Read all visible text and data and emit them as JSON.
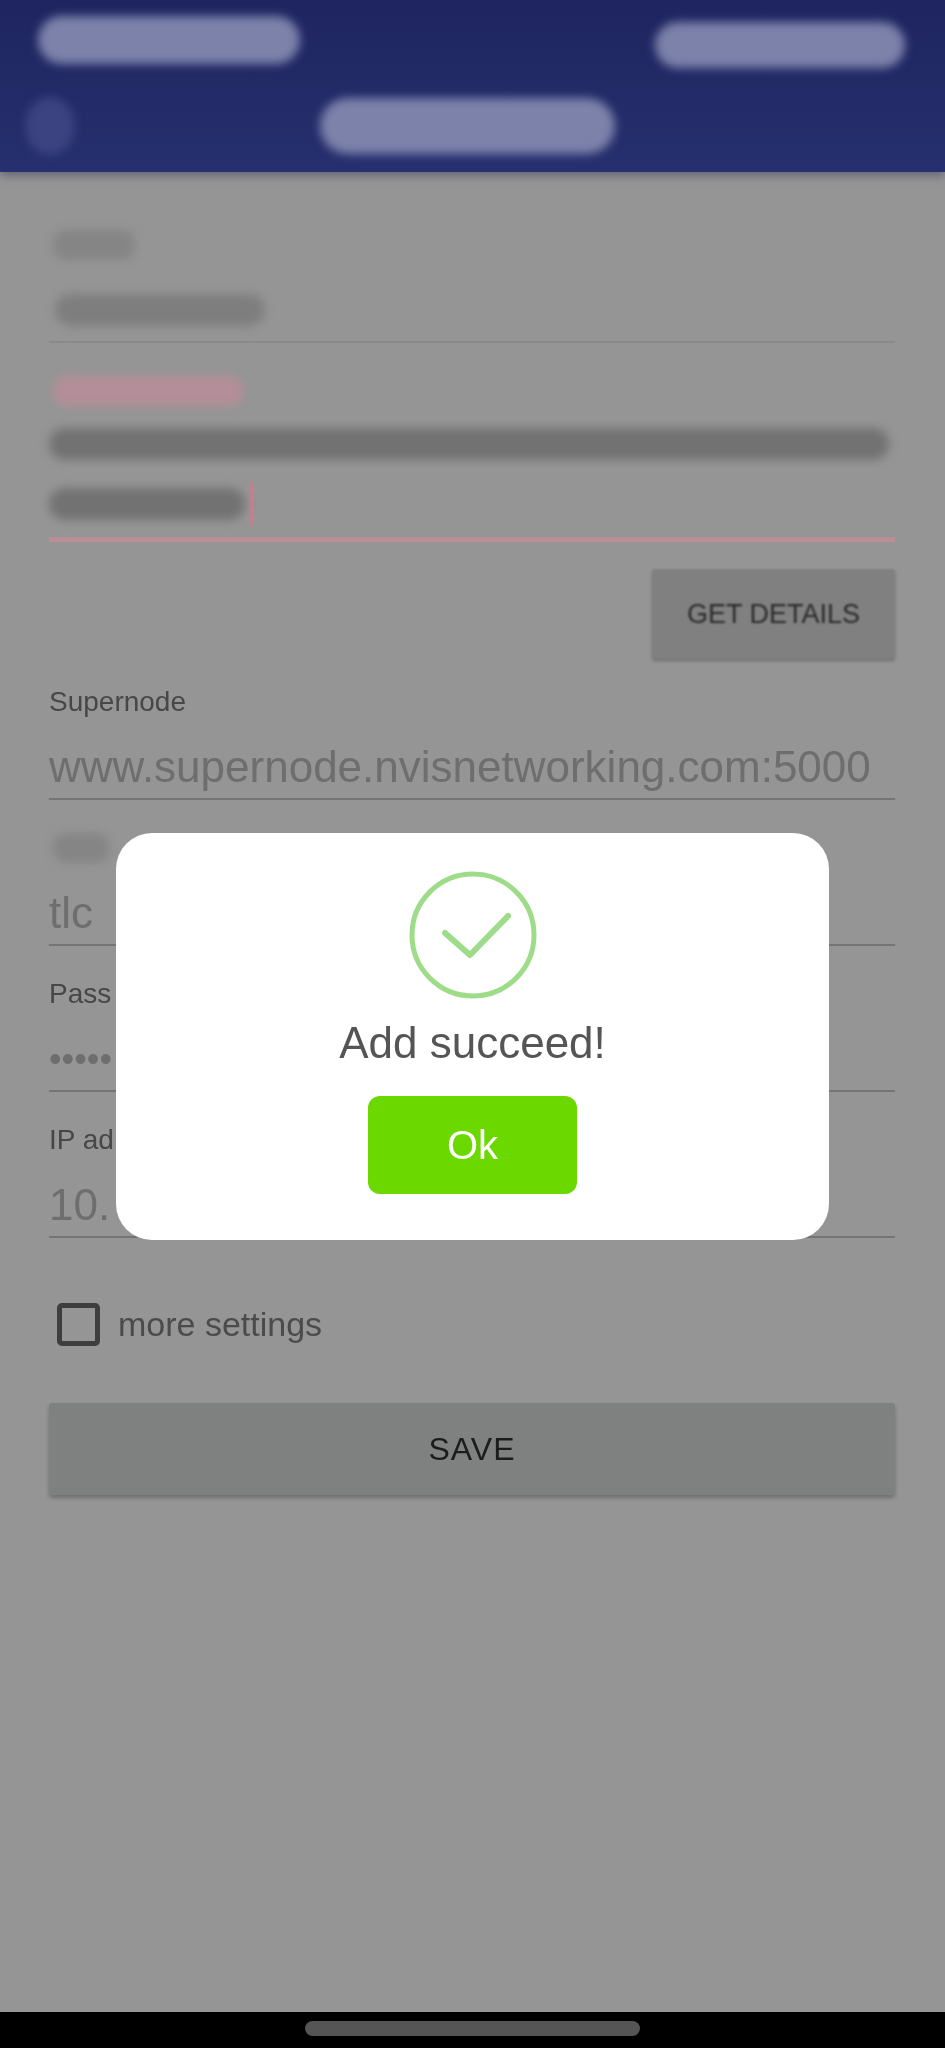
{
  "status_bar": {
    "redacted": true
  },
  "app_bar": {
    "back_redacted": true,
    "title_redacted": true
  },
  "form": [
    {
      "kind": "field",
      "label_redacted": true,
      "value_redacted": true,
      "multiline": false,
      "error": false,
      "focused": false
    },
    {
      "kind": "field",
      "label_redacted": true,
      "value_redacted": true,
      "multiline": true,
      "error": true,
      "focused": true
    },
    {
      "kind": "button",
      "label": "GET DETAILS"
    },
    {
      "kind": "field",
      "label": "Supernode",
      "value": "www.supernode.nvisnetworking.com:5000",
      "error": false,
      "focused": false
    },
    {
      "kind": "field",
      "label_redacted": true,
      "value": "tlc",
      "error": false,
      "focused": false
    },
    {
      "kind": "field",
      "label": "Pass",
      "value": "•••••",
      "error": false,
      "focused": false
    },
    {
      "kind": "field",
      "label": "IP ad",
      "value": "10.",
      "error": false,
      "focused": false
    }
  ],
  "checkbox": {
    "label": "more settings",
    "checked": false
  },
  "save_button": {
    "label": "SAVE"
  },
  "dialog": {
    "message": "Add succeed!",
    "button": "Ok"
  }
}
